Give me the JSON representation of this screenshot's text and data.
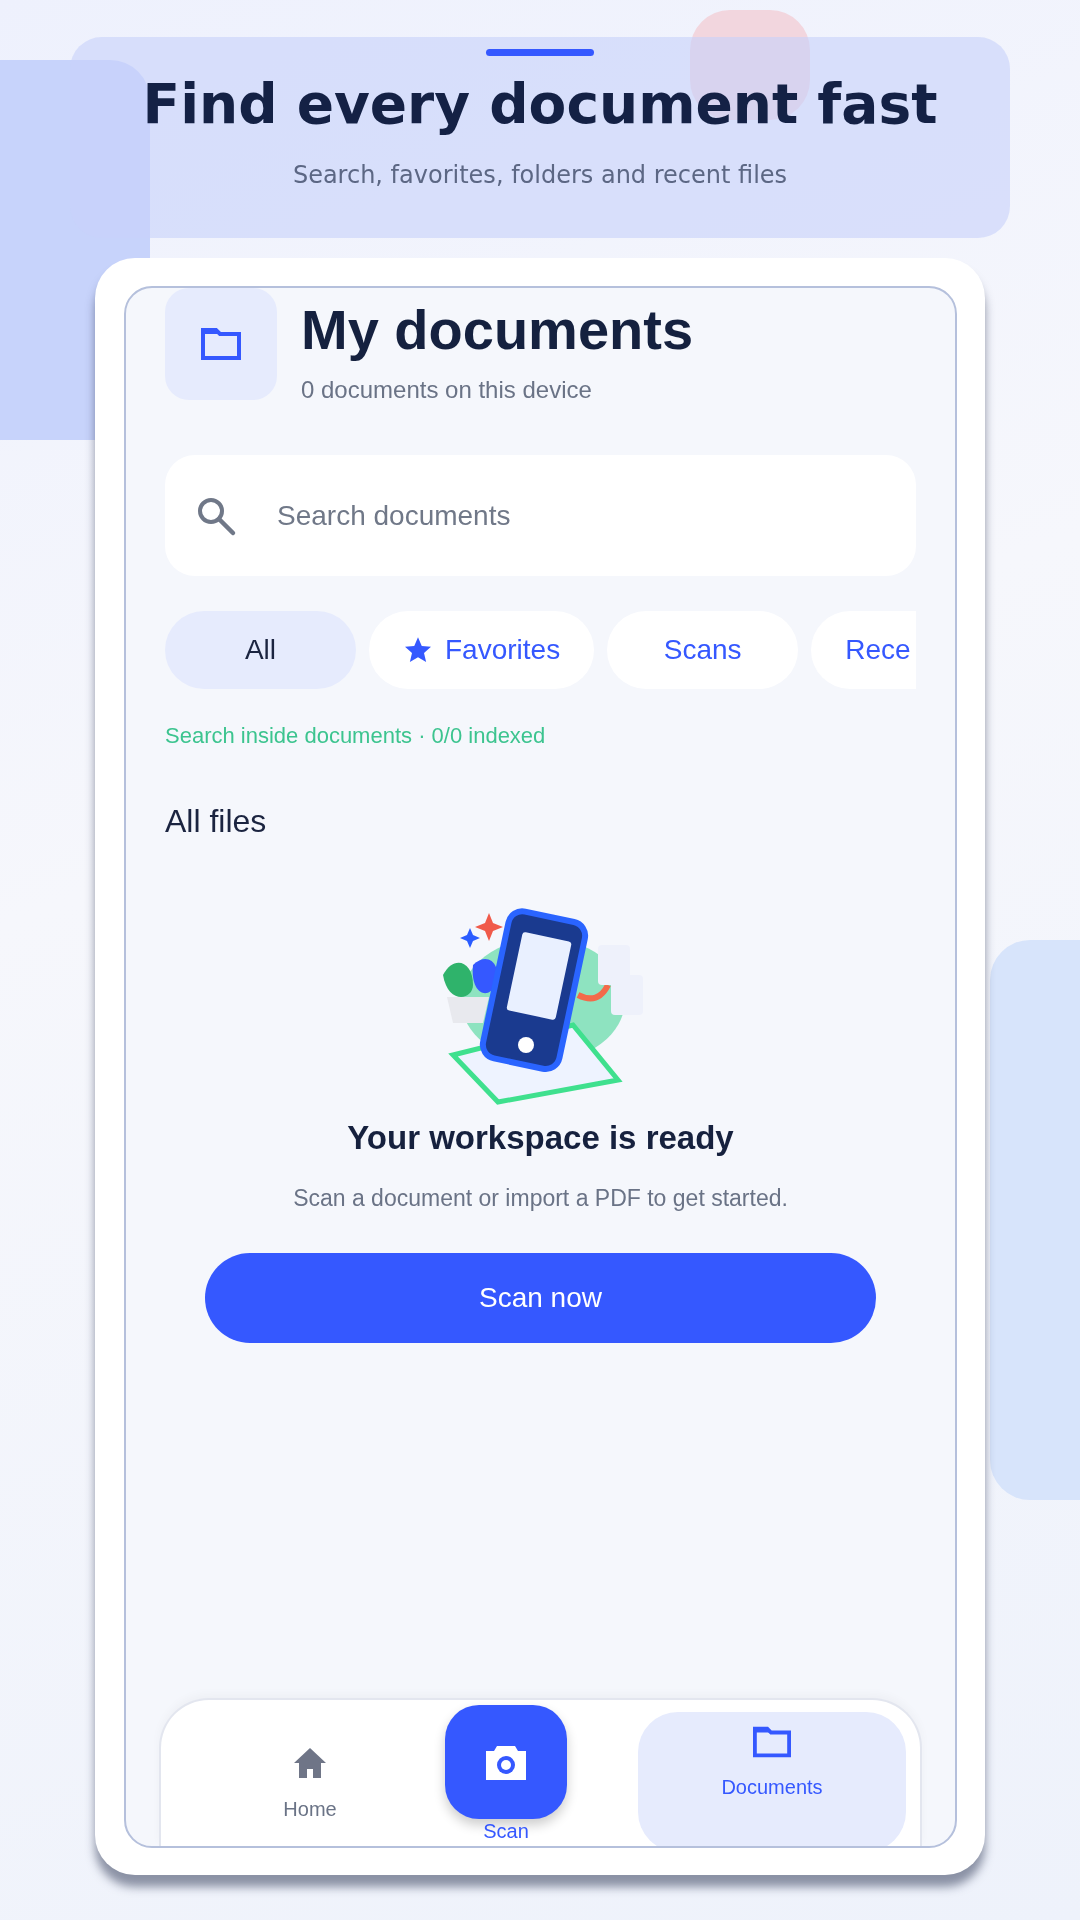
{
  "banner": {
    "title": "Find every document fast",
    "subtitle": "Search, favorites, folders and recent files"
  },
  "header": {
    "title": "My documents",
    "subtitle": "0 documents on this device"
  },
  "search": {
    "placeholder": "Search documents"
  },
  "filters": [
    {
      "label": "All",
      "kind": "text",
      "selected": true
    },
    {
      "label": "Favorites",
      "kind": "star",
      "selected": false
    },
    {
      "label": "Scans",
      "kind": "text",
      "selected": false
    },
    {
      "label": "Rece",
      "kind": "text",
      "selected": false
    }
  ],
  "index_status": "Search inside documents · 0/0 indexed",
  "section_title": "All files",
  "empty_state": {
    "title": "Your workspace is ready",
    "message": "Scan a document or import a PDF to get started.",
    "button": "Scan now"
  },
  "bottom_nav": [
    {
      "label": "Home",
      "kind": "home",
      "selected": false
    },
    {
      "label": "Scan",
      "kind": "scan",
      "selected": false
    },
    {
      "label": "Documents",
      "kind": "documents",
      "selected": true
    }
  ]
}
